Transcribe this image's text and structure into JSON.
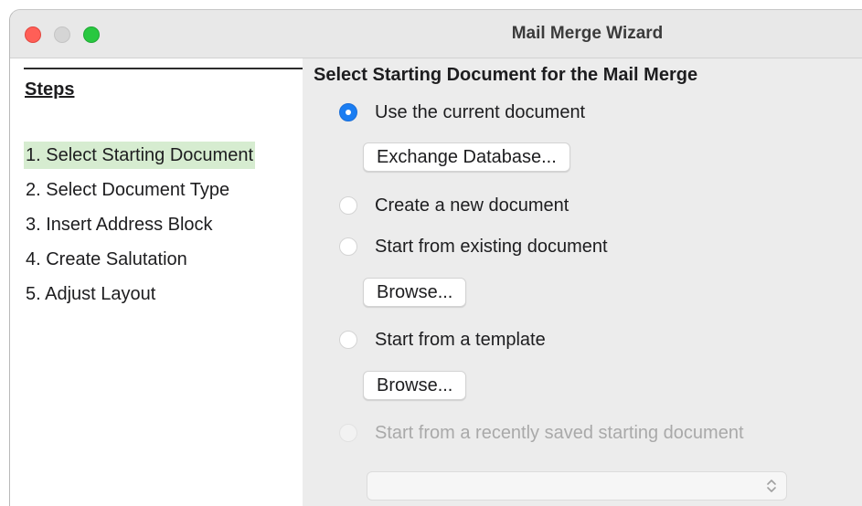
{
  "window": {
    "title": "Mail Merge Wizard"
  },
  "steps": {
    "heading": "Steps",
    "items": [
      {
        "label": "1. Select Starting Document",
        "active": true
      },
      {
        "label": "2. Select Document Type",
        "active": false
      },
      {
        "label": "3. Insert Address Block",
        "active": false
      },
      {
        "label": "4. Create Salutation",
        "active": false
      },
      {
        "label": "5. Adjust Layout",
        "active": false
      }
    ]
  },
  "content": {
    "title": "Select Starting Document for the Mail Merge",
    "options": {
      "current": {
        "label": "Use the current document",
        "checked": true
      },
      "new": {
        "label": "Create a new document",
        "checked": false
      },
      "existing": {
        "label": "Start from existing document",
        "checked": false
      },
      "template": {
        "label": "Start from a template",
        "checked": false
      },
      "recent": {
        "label": "Start from a recently saved starting document",
        "checked": false,
        "disabled": true
      }
    },
    "exchange_button": "Exchange Database...",
    "browse_existing_button": "Browse...",
    "browse_template_button": "Browse...",
    "recent_select": {
      "value": ""
    }
  },
  "colors": {
    "accent": "#1a7df2",
    "active_step": "#d6ecd0",
    "close": "#ff5f57",
    "minimize": "#d5d5d5",
    "maximize": "#28c840"
  },
  "icons": {
    "select": "chevron-up-down-icon"
  }
}
